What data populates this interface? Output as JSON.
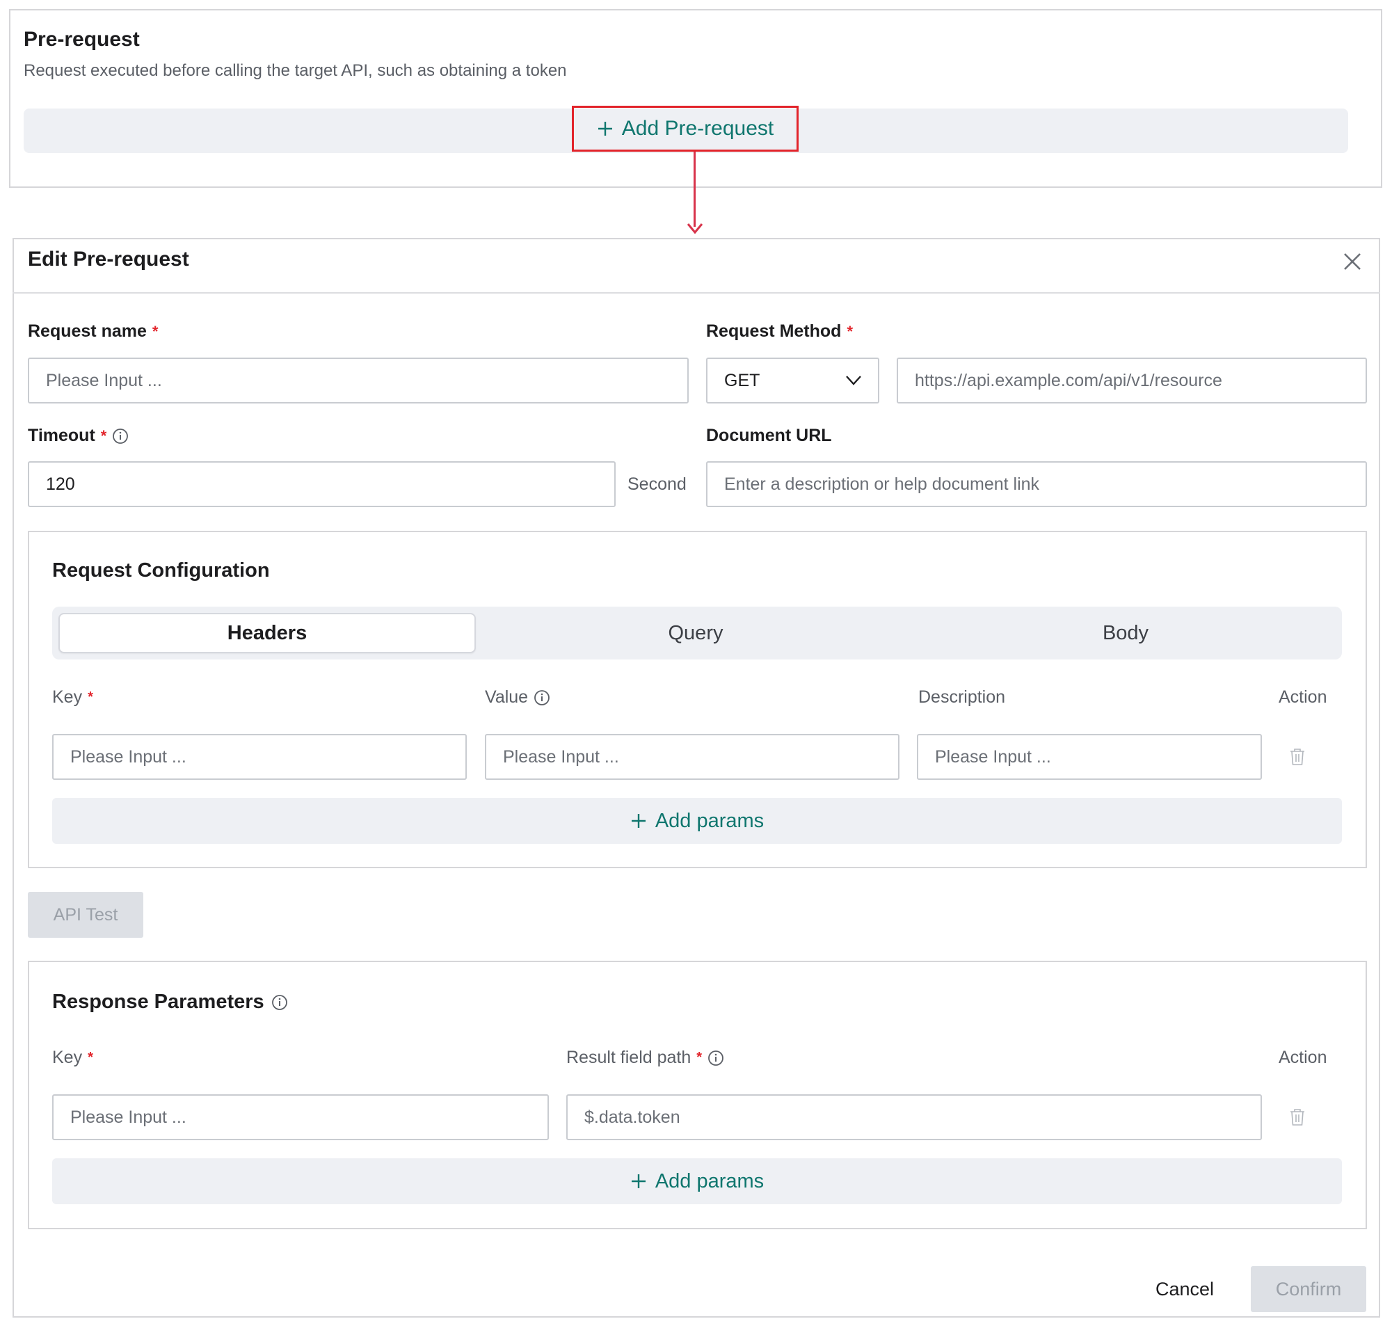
{
  "pre_request": {
    "title": "Pre-request",
    "description": "Request executed before calling the target API, such as obtaining a token",
    "add_button_label": "Add Pre-request"
  },
  "modal": {
    "title": "Edit Pre-request",
    "request_name": {
      "label": "Request name",
      "required_mark": "*",
      "placeholder": "Please Input ..."
    },
    "request_method": {
      "label": "Request Method",
      "required_mark": "*",
      "selected": "GET",
      "url_placeholder": "https://api.example.com/api/v1/resource"
    },
    "timeout": {
      "label": "Timeout",
      "required_mark": "*",
      "value": "120",
      "unit": "Second"
    },
    "document_url": {
      "label": "Document URL",
      "placeholder": "Enter a description or help document link"
    },
    "request_config": {
      "title": "Request Configuration",
      "tabs": [
        "Headers",
        "Query",
        "Body"
      ],
      "active_tab": "Headers",
      "columns": {
        "key": "Key",
        "key_required": "*",
        "value": "Value",
        "description": "Description",
        "action": "Action"
      },
      "row": {
        "key_placeholder": "Please Input ...",
        "value_placeholder": "Please Input ...",
        "description_placeholder": "Please Input ..."
      },
      "add_params_label": "Add params"
    },
    "api_test_label": "API Test",
    "response_params": {
      "title": "Response Parameters",
      "columns": {
        "key": "Key",
        "key_required": "*",
        "path": "Result field path",
        "path_required": "*",
        "action": "Action"
      },
      "row": {
        "key_placeholder": "Please Input ...",
        "path_placeholder": "$.data.token"
      },
      "add_params_label": "Add params"
    },
    "cancel_label": "Cancel",
    "confirm_label": "Confirm"
  },
  "colors": {
    "accent": "#0f766e",
    "required": "#e2242b",
    "highlight_box": "#e2242b",
    "arrow": "#d8344b",
    "muted_bg": "#eef0f4",
    "disabled_btn_bg": "#dde0e5"
  },
  "icons": {
    "plus": "plus-icon",
    "close": "close-icon",
    "chevron": "chevron-down-icon",
    "info": "info-icon",
    "trash": "trash-icon",
    "arrow": "arrow-down-icon"
  }
}
